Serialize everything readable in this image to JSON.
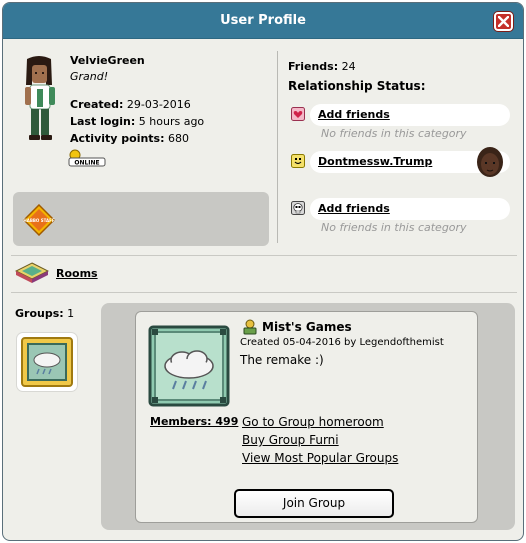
{
  "window": {
    "title": "User Profile"
  },
  "profile": {
    "username": "VelvieGreen",
    "motto": "Grand!",
    "created_label": "Created:",
    "created_value": "29-03-2016",
    "last_login_label": "Last login:",
    "last_login_value": "5 hours ago",
    "activity_label": "Activity points:",
    "activity_value": "680",
    "online_badge": "ONLINE",
    "staff_badge_text": "HABBO STAFF"
  },
  "relationships": {
    "friends_label": "Friends:",
    "friends_count": "24",
    "status_title": "Relationship Status:",
    "rows": [
      {
        "icon": "heart-icon",
        "link": "Add friends",
        "empty_text": "No friends in this category"
      },
      {
        "icon": "smile-icon",
        "link": "Dontmessw.Trump"
      },
      {
        "icon": "skull-icon",
        "link": "Add friends",
        "empty_text": "No friends in this category"
      }
    ]
  },
  "rooms": {
    "label": "Rooms"
  },
  "groups": {
    "count_label": "Groups:",
    "count_value": "1",
    "selected": {
      "name": "Mist's Games",
      "created": "Created 05-04-2016 by Legendofthemist",
      "description": "The remake :)",
      "members": "Members: 499",
      "links": [
        "Go to Group homeroom",
        "Buy Group Furni",
        "View Most Popular Groups"
      ],
      "join_button": "Join Group"
    }
  },
  "colors": {
    "titlebar": "#367897",
    "window_bg": "#efefea",
    "panel_bg": "#c8c8c4",
    "close_red": "#c4302a",
    "empty_text": "#999999"
  }
}
